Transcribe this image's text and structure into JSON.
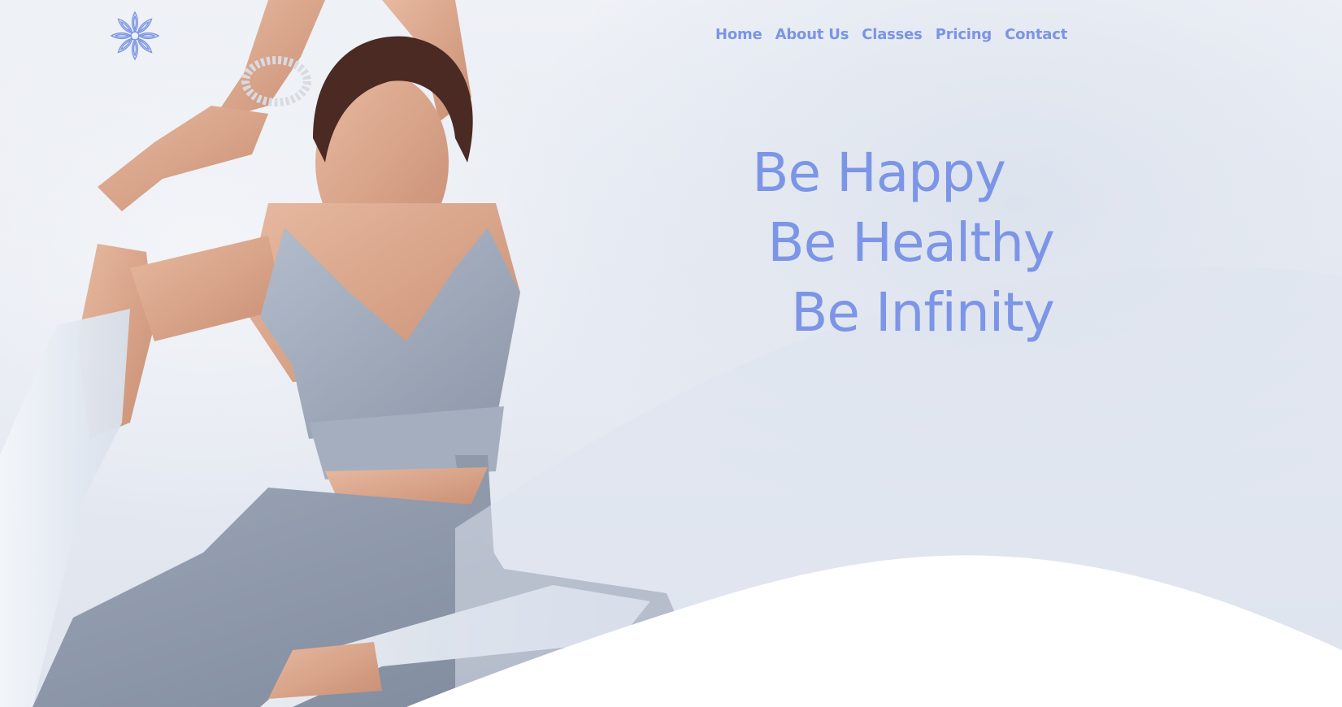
{
  "nav": {
    "items": [
      {
        "label": "Home"
      },
      {
        "label": "About Us"
      },
      {
        "label": "Classes"
      },
      {
        "label": "Pricing"
      },
      {
        "label": "Contact"
      }
    ]
  },
  "hero": {
    "lines": [
      "Be Happy",
      "Be Healthy",
      "Be Infinity"
    ]
  },
  "logo": {
    "icon": "lotus-mandala-icon"
  },
  "colors": {
    "accent": "#7b95e2",
    "background": "#e9edf4",
    "wave": "#ffffff"
  }
}
